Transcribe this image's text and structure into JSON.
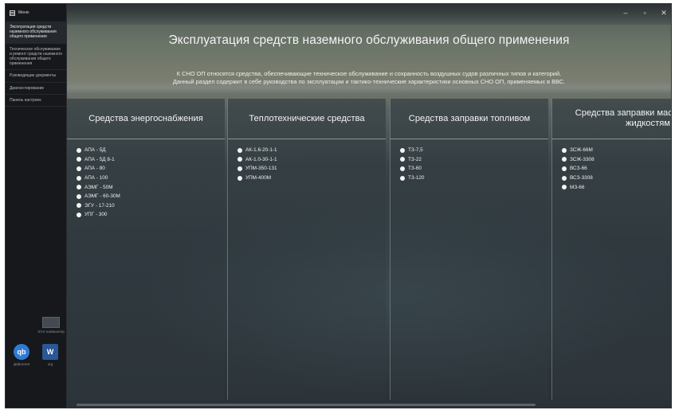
{
  "window": {
    "controls": [
      "–",
      "▫",
      "✕"
    ]
  },
  "sidebar": {
    "menu_label": "Меню",
    "items": [
      {
        "label": "Эксплуатация средств наземного обслуживания общего применения",
        "active": true
      },
      {
        "label": "Техническое обслуживание и ремонт средств наземного обслуживания общего применения",
        "active": false
      },
      {
        "label": "Руководящие документы",
        "active": false
      },
      {
        "label": "Диагностирование",
        "active": false
      },
      {
        "label": "Панель настроек",
        "active": false
      }
    ],
    "desktop": {
      "pc_label": "Этот компьютер",
      "icons": [
        {
          "label": "qbittorrent",
          "glyph": "qb",
          "icon": "qbittorrent-icon"
        },
        {
          "label": "org",
          "glyph": "W",
          "icon": "word-document-icon"
        }
      ]
    }
  },
  "page": {
    "title": "Эксплуатация средств наземного обслуживания общего применения",
    "intro_line1": "К СНО ОП относятся средства, обеспечивающие техническое обслуживание и сохранность воздушных судов различных типов и категорий.",
    "intro_line2": "Данный раздел содержит в себе руководства по эксплуатации и тактико-технические характеристики основных СНО ОП, применяемых в ВВС."
  },
  "categories": [
    {
      "title": "Средства энергоснабжения",
      "items": [
        "АПА - 5Д",
        "АПА - 5Д 8-1",
        "АПА - 80",
        "АПА - 100",
        "АЭМГ - 50М",
        "АЭМГ - 60-30М",
        "ЭГУ - 17-210",
        "УПГ - 300"
      ]
    },
    {
      "title": "Теплотехнические средства",
      "items": [
        "АК-1.6-20-1-1",
        "АК-1.0-30-1-1",
        "УПМ-350-131",
        "УПМ-400М"
      ]
    },
    {
      "title": "Средства заправки топливом",
      "items": [
        "ТЗ-7,5",
        "ТЗ-22",
        "ТЗ-60",
        "ТЗ-120"
      ]
    },
    {
      "title": "Средства заправки масл рабочими жидкостям",
      "items": [
        "ЗСЖ-66М",
        "ЗСЖ-3308",
        "ВСЗ-66",
        "ВСЗ-3308",
        "МЗ-66"
      ]
    }
  ],
  "colors": {
    "sidebar_bg": "#16181b",
    "text": "#eeeeee",
    "bullet": "#f4f4f4"
  }
}
